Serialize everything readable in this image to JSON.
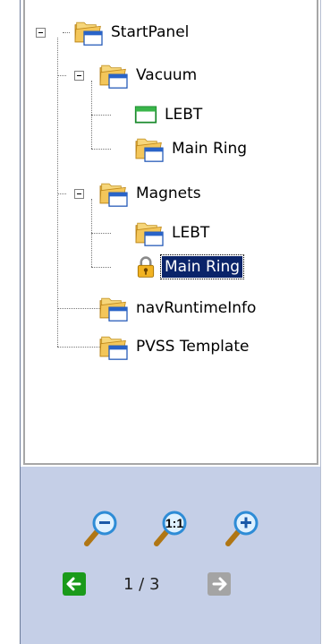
{
  "tree": {
    "root": {
      "label": "StartPanel",
      "icon": "folder-window-icon"
    },
    "nodes": [
      {
        "id": "vacuum",
        "label": "Vacuum",
        "icon": "folder-window-icon"
      },
      {
        "id": "vacuum-lebt",
        "label": "LEBT",
        "icon": "window-green-icon"
      },
      {
        "id": "vacuum-main-ring",
        "label": "Main Ring",
        "icon": "folder-window-icon"
      },
      {
        "id": "magnets",
        "label": "Magnets",
        "icon": "folder-window-icon"
      },
      {
        "id": "magnets-lebt",
        "label": "LEBT",
        "icon": "folder-window-icon"
      },
      {
        "id": "magnets-main-ring",
        "label": "Main Ring",
        "icon": "lock-icon",
        "selected": true
      },
      {
        "id": "nav-runtime-info",
        "label": "navRuntimeInfo",
        "icon": "folder-window-icon"
      },
      {
        "id": "pvss-template",
        "label": "PVSS Template",
        "icon": "folder-window-icon"
      }
    ]
  },
  "zoom": {
    "zoom_out_icon": "zoom-out-icon",
    "actual_size_label": "1:1",
    "zoom_in_icon": "zoom-in-icon"
  },
  "paging": {
    "text": "1 / 3",
    "prev_icon": "arrow-left-icon",
    "next_icon": "arrow-right-icon",
    "prev_color": "#1a9a1a",
    "next_color": "#a4a4a4"
  }
}
